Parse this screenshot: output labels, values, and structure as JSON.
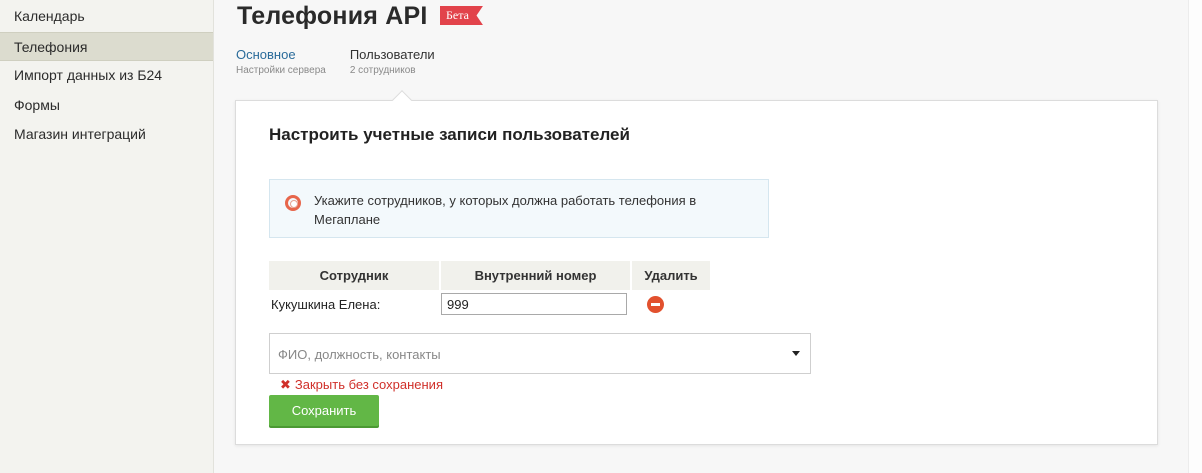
{
  "sidebar": {
    "items": [
      {
        "label": "Календарь"
      },
      {
        "label": "Телефония"
      },
      {
        "label": "Импорт данных из Б24"
      },
      {
        "label": "Формы"
      },
      {
        "label": "Магазин интеграций"
      }
    ]
  },
  "header": {
    "title": "Телефония API",
    "badge": "Бета"
  },
  "tabs": [
    {
      "label": "Основное",
      "sub": "Настройки сервера"
    },
    {
      "label": "Пользователи",
      "sub": "2 сотрудников"
    }
  ],
  "card": {
    "title": "Настроить учетные записи пользователей",
    "info": "Укажите сотрудников, у которых должна работать телефония в Мегаплане",
    "table": {
      "headers": [
        "Сотрудник",
        "Внутренний номер",
        "Удалить"
      ],
      "rows": [
        {
          "employee": "Кукушкина Елена:",
          "number": "999"
        }
      ]
    },
    "select_placeholder": "ФИО, должность, контакты",
    "close_link": "Закрыть без сохранения",
    "close_icon_glyph": "✖",
    "save_label": "Сохранить"
  },
  "colors": {
    "accent_link": "#2a6b9a",
    "badge": "#e2434b",
    "save_button": "#62b746",
    "danger": "#d0302a"
  }
}
